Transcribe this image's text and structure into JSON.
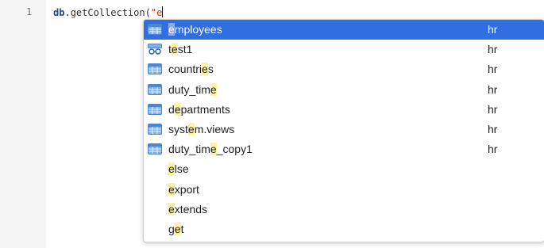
{
  "editor": {
    "line_number": "1",
    "code": {
      "object": "db",
      "dot": ".",
      "method": "getCollection(",
      "string_open": "\"e"
    }
  },
  "autocomplete": {
    "accent_color": "#2f6fdf",
    "match_highlight_color": "#fbf3a6",
    "items": [
      {
        "icon": "table-icon",
        "pre": "",
        "match": "e",
        "post": "mployees",
        "meta": "hr",
        "selected": true
      },
      {
        "icon": "view-icon",
        "pre": "t",
        "match": "e",
        "post": "st1",
        "meta": "hr",
        "selected": false
      },
      {
        "icon": "table-icon",
        "pre": "countri",
        "match": "e",
        "post": "s",
        "meta": "hr",
        "selected": false
      },
      {
        "icon": "table-icon",
        "pre": "duty_tim",
        "match": "e",
        "post": "",
        "meta": "hr",
        "selected": false
      },
      {
        "icon": "table-icon",
        "pre": "d",
        "match": "e",
        "post": "partments",
        "meta": "hr",
        "selected": false
      },
      {
        "icon": "table-icon",
        "pre": "syst",
        "match": "e",
        "post": "m.views",
        "meta": "hr",
        "selected": false
      },
      {
        "icon": "table-icon",
        "pre": "duty_tim",
        "match": "e",
        "post": "_copy1",
        "meta": "hr",
        "selected": false
      },
      {
        "icon": "",
        "pre": "",
        "match": "e",
        "post": "lse",
        "meta": "",
        "selected": false
      },
      {
        "icon": "",
        "pre": "",
        "match": "e",
        "post": "xport",
        "meta": "",
        "selected": false
      },
      {
        "icon": "",
        "pre": "",
        "match": "e",
        "post": "xtends",
        "meta": "",
        "selected": false
      },
      {
        "icon": "",
        "pre": "g",
        "match": "e",
        "post": "t",
        "meta": "",
        "selected": false
      }
    ]
  }
}
